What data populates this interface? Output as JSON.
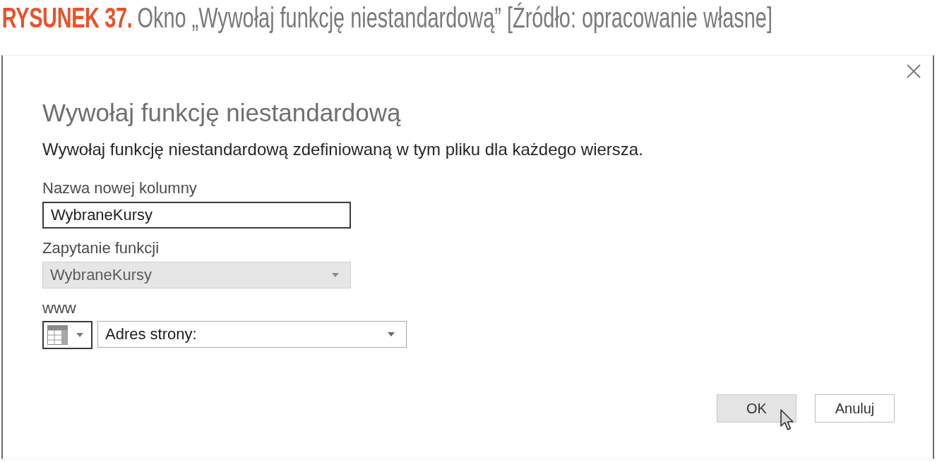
{
  "caption": {
    "label": "RYSUNEK 37.",
    "text": "Okno „Wywołaj funkcję niestandardową” [Źródło: opracowanie własne]"
  },
  "dialog": {
    "title": "Wywołaj funkcję niestandardową",
    "description": "Wywołaj funkcję niestandardową zdefiniowaną w tym pliku dla każdego wiersza.",
    "fields": [
      {
        "kind": "text",
        "label": "Nazwa nowej kolumny",
        "value": "WybraneKursy",
        "disabled": false
      },
      {
        "kind": "dropdown",
        "label": "Zapytanie funkcji",
        "value": "WybraneKursy",
        "disabled": true
      },
      {
        "kind": "typed-dropdown",
        "label": "www",
        "value": "Adres strony:",
        "disabled": false
      }
    ],
    "buttons": [
      {
        "label": "OK",
        "hovered": true
      },
      {
        "label": "Anuluj",
        "hovered": false
      }
    ]
  }
}
